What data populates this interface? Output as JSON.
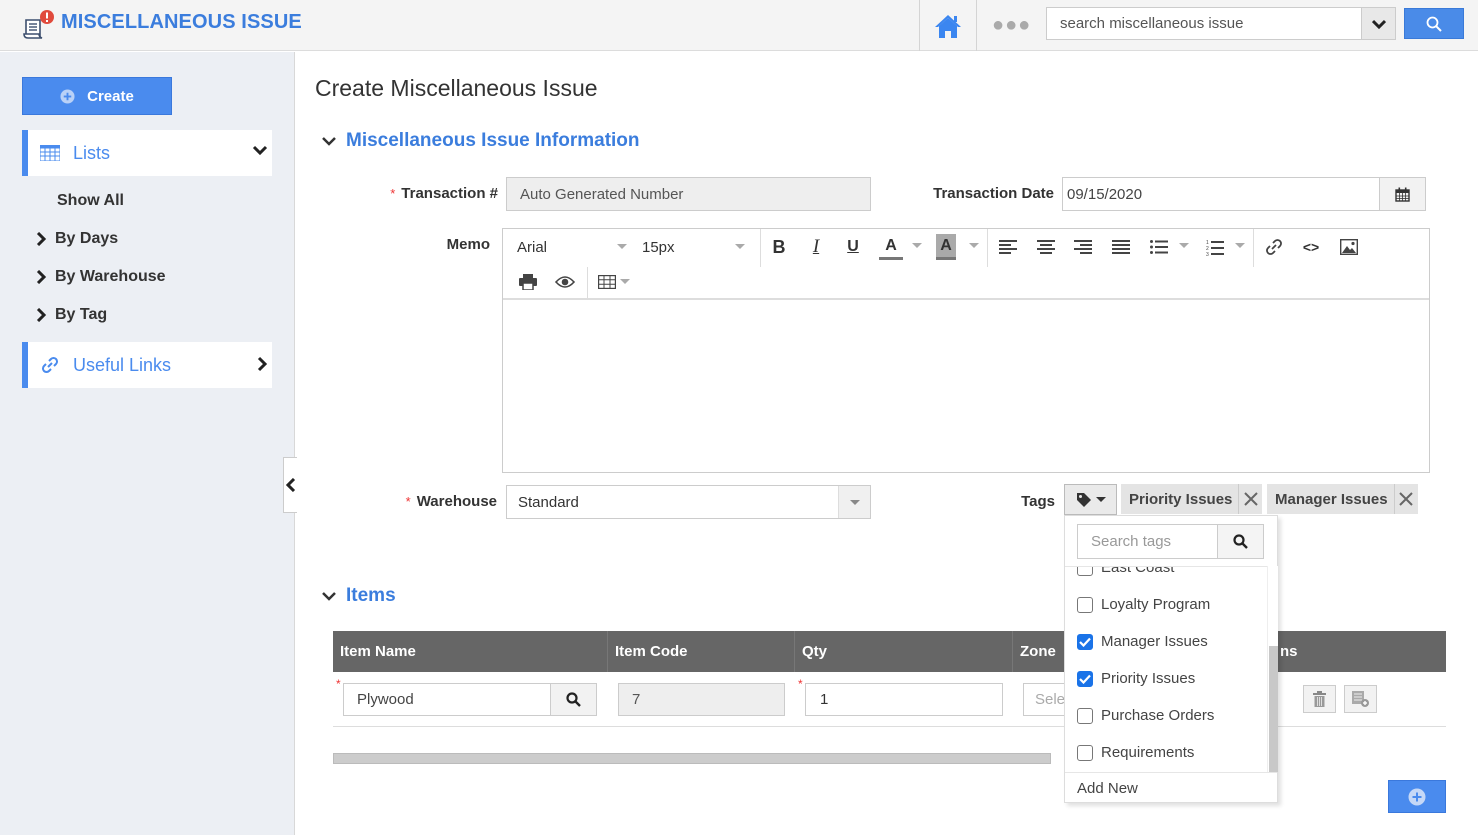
{
  "header": {
    "title": "MISCELLANEOUS ISSUE",
    "search_placeholder": "search miscellaneous issue",
    "more_label": "●●●",
    "accent_color": "#3b7ddd"
  },
  "sidebar": {
    "create_label": "Create",
    "lists_label": "Lists",
    "list_items": [
      {
        "label": "Show All",
        "has_chevron": false
      },
      {
        "label": "By Days",
        "has_chevron": true
      },
      {
        "label": "By Warehouse",
        "has_chevron": true
      },
      {
        "label": "By Tag",
        "has_chevron": true
      }
    ],
    "useful_links_label": "Useful Links"
  },
  "page": {
    "title": "Create Miscellaneous Issue",
    "info_section_title": "Miscellaneous Issue Information",
    "items_section_title": "Items"
  },
  "form": {
    "transaction_label": "Transaction #",
    "transaction_value": "Auto Generated Number",
    "date_label": "Transaction Date",
    "date_value": "09/15/2020",
    "memo_label": "Memo",
    "warehouse_label": "Warehouse",
    "warehouse_value": "Standard",
    "tags_label": "Tags",
    "required_mark": "*"
  },
  "editor": {
    "font_family": "Arial",
    "font_size": "15px",
    "bold": "B",
    "italic": "I",
    "underline": "U",
    "font_color": "A",
    "bg_color": "A",
    "code": "<>"
  },
  "tags": {
    "selected": [
      "Priority Issues",
      "Manager Issues"
    ],
    "search_placeholder": "Search tags",
    "options": [
      {
        "label": "East Coast",
        "checked": false
      },
      {
        "label": "Loyalty Program",
        "checked": false
      },
      {
        "label": "Manager Issues",
        "checked": true
      },
      {
        "label": "Priority Issues",
        "checked": true
      },
      {
        "label": "Purchase Orders",
        "checked": false
      },
      {
        "label": "Requirements",
        "checked": false
      }
    ],
    "add_new_label": "Add New"
  },
  "items_table": {
    "columns": [
      "Item Name",
      "Item Code",
      "Qty",
      "Zone",
      "Actions"
    ],
    "visible_partial_column": "ns",
    "rows": [
      {
        "item_name": "Plywood",
        "item_code": "7",
        "qty": "1",
        "zone_placeholder": "Select"
      }
    ]
  }
}
